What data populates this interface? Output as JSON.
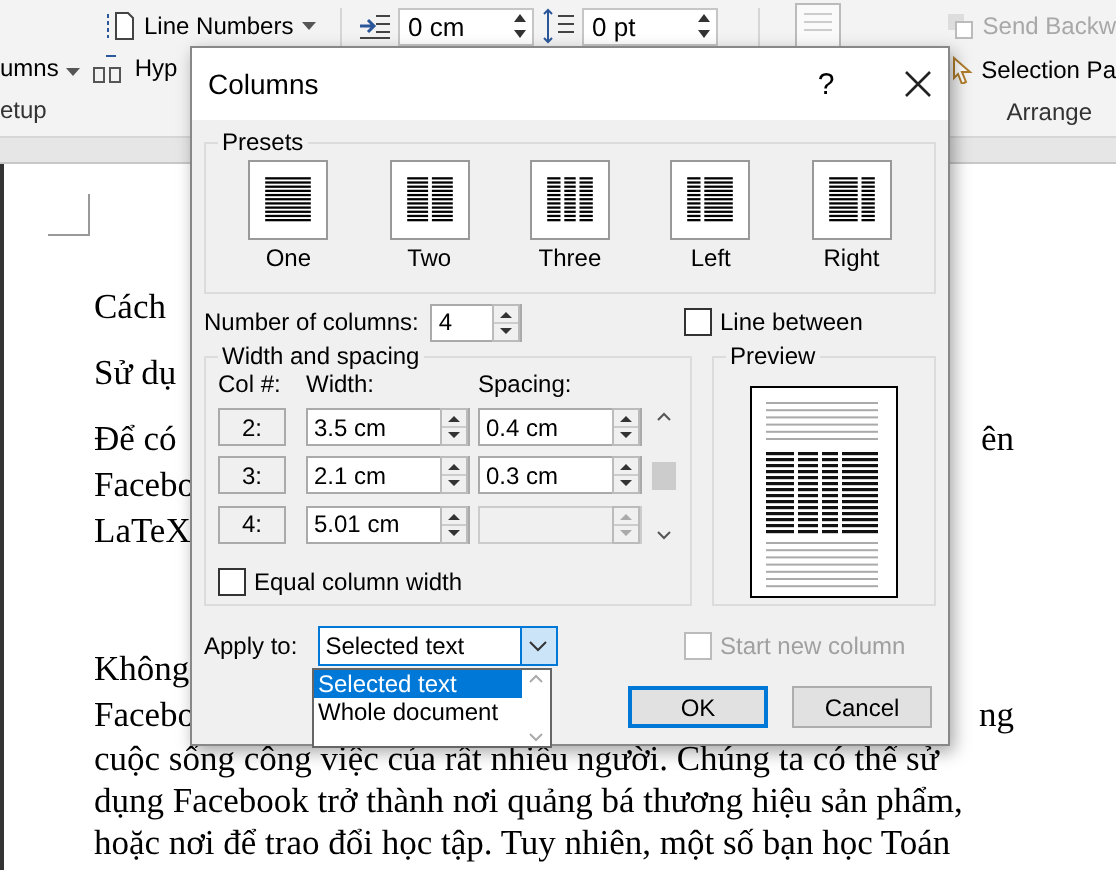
{
  "ribbon": {
    "line_numbers": "Line Numbers",
    "columns": "umns",
    "hyphenation": "Hyp",
    "indent": "0 cm",
    "spacing": "0 pt",
    "send_backward": "Send Backw",
    "selection_pane": "Selection Pa",
    "group_labels": [
      "etup",
      "Arrange"
    ]
  },
  "document": {
    "paragraphs": [
      {
        "lines": [
          {
            "text": "Cách"
          }
        ]
      },
      {
        "lines": [
          {
            "text": "Sử dụ"
          }
        ]
      },
      {
        "lines": [
          {
            "text": "Để có",
            "right": "ên"
          },
          {
            "text": "Facebo"
          },
          {
            "text": "LaTeX"
          }
        ]
      },
      {
        "lines": [
          {
            "text": "Không"
          },
          {
            "text": "Facebo",
            "right": "ng"
          },
          {
            "text": "cuộc sống công việc của rất nhiều người. Chúng ta có thể sử"
          },
          {
            "text": "dụng Facebook trở thành nơi quảng bá thương hiệu sản phẩm,"
          },
          {
            "text": "hoặc nơi để trao đổi học tập. Tuy nhiên, một số bạn học Toán"
          }
        ]
      }
    ]
  },
  "dialog": {
    "title": "Columns",
    "help": "?",
    "presets": {
      "label": "Presets",
      "items": [
        {
          "label": "One",
          "kind": "one",
          "selected": false
        },
        {
          "label": "Two",
          "kind": "two",
          "selected": false
        },
        {
          "label": "Three",
          "kind": "three",
          "selected": false
        },
        {
          "label": "Left",
          "kind": "left",
          "selected": false
        },
        {
          "label": "Right",
          "kind": "right",
          "selected": false
        }
      ]
    },
    "number_of_columns": {
      "label": "Number of columns:",
      "value": "4"
    },
    "line_between": {
      "label": "Line between",
      "checked": false
    },
    "width_spacing": {
      "label": "Width and spacing",
      "headers": [
        "Col #:",
        "Width:",
        "Spacing:"
      ],
      "rows": [
        {
          "col": "2:",
          "width": "3.5 cm",
          "spacing": "0.4 cm",
          "spacing_disabled": false
        },
        {
          "col": "3:",
          "width": "2.1 cm",
          "spacing": "0.3 cm",
          "spacing_disabled": false
        },
        {
          "col": "4:",
          "width": "5.01 cm",
          "spacing_disabled": true
        }
      ]
    },
    "equal_width": {
      "label": "Equal column width",
      "checked": false
    },
    "preview": {
      "label": "Preview"
    },
    "apply_to": {
      "label": "Apply to:",
      "value": "Selected text",
      "open": true,
      "options": [
        {
          "label": "Selected text",
          "selected": true
        },
        {
          "label": "Whole document",
          "selected": false
        }
      ]
    },
    "start_new_column": {
      "label": "Start new column",
      "checked": false,
      "disabled": true
    },
    "buttons": [
      {
        "label": "OK",
        "default": true
      },
      {
        "label": "Cancel",
        "default": false
      }
    ]
  }
}
